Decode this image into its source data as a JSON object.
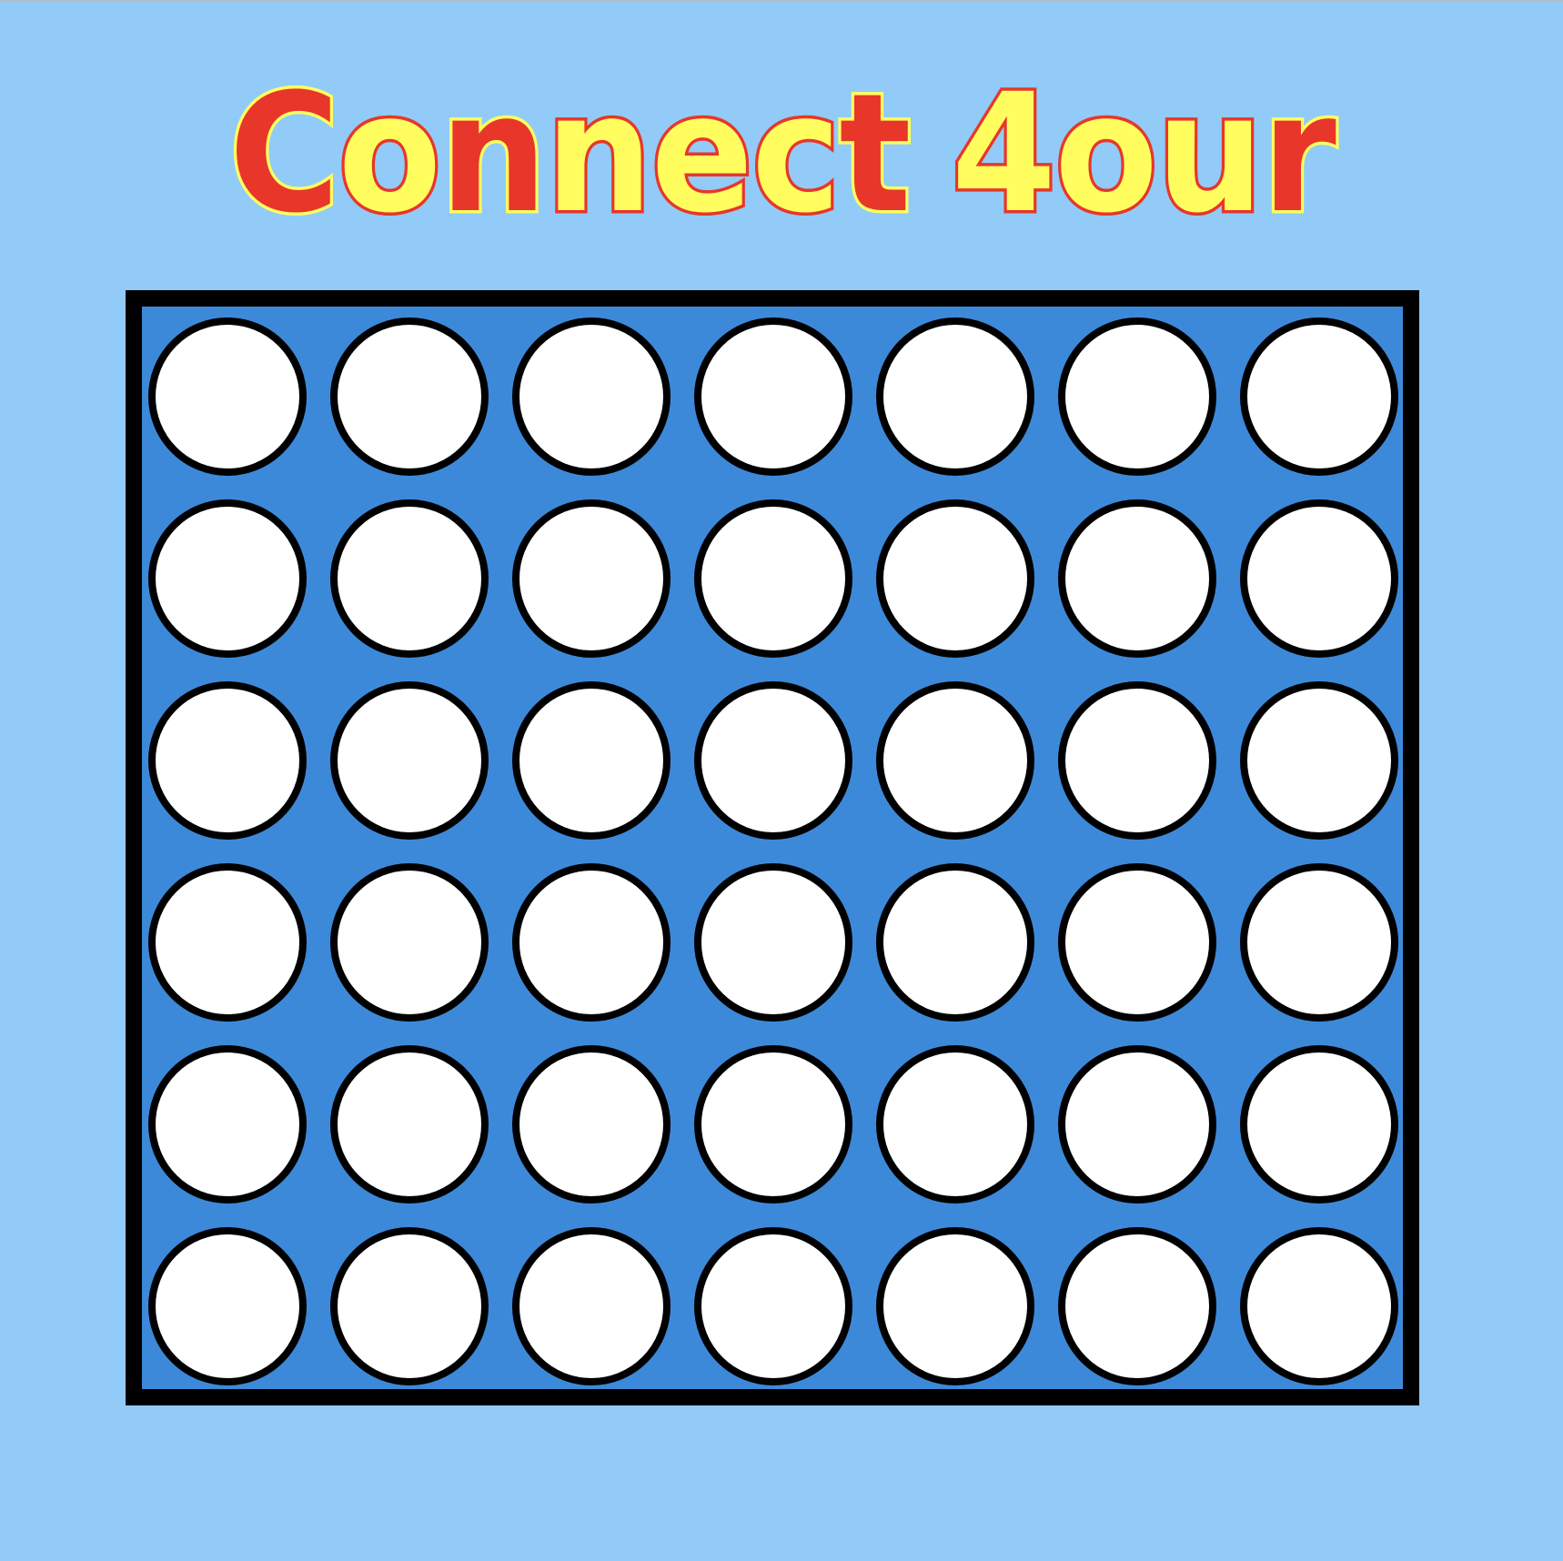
{
  "title": {
    "text": "Connect 4our",
    "letters": [
      {
        "char": "C",
        "color": "red"
      },
      {
        "char": "o",
        "color": "yellow"
      },
      {
        "char": "n",
        "color": "red"
      },
      {
        "char": "n",
        "color": "yellow"
      },
      {
        "char": "e",
        "color": "yellow"
      },
      {
        "char": "c",
        "color": "yellow"
      },
      {
        "char": "t",
        "color": "red"
      },
      {
        "char": " ",
        "color": "space"
      },
      {
        "char": "4",
        "color": "yellow"
      },
      {
        "char": "o",
        "color": "yellow"
      },
      {
        "char": "u",
        "color": "yellow"
      },
      {
        "char": "r",
        "color": "red"
      }
    ]
  },
  "board": {
    "rows": 6,
    "columns": 7,
    "cells": [
      [
        "empty",
        "empty",
        "empty",
        "empty",
        "empty",
        "empty",
        "empty"
      ],
      [
        "empty",
        "empty",
        "empty",
        "empty",
        "empty",
        "empty",
        "empty"
      ],
      [
        "empty",
        "empty",
        "empty",
        "empty",
        "empty",
        "empty",
        "empty"
      ],
      [
        "empty",
        "empty",
        "empty",
        "empty",
        "empty",
        "empty",
        "empty"
      ],
      [
        "empty",
        "empty",
        "empty",
        "empty",
        "empty",
        "empty",
        "empty"
      ],
      [
        "empty",
        "empty",
        "empty",
        "empty",
        "empty",
        "empty",
        "empty"
      ]
    ]
  },
  "colors": {
    "background": "#92cbf7",
    "board": "#3d89d9",
    "board_border": "#000000",
    "hole": "#ffffff",
    "title_red": "#e8362a",
    "title_yellow": "#fffe5e"
  }
}
